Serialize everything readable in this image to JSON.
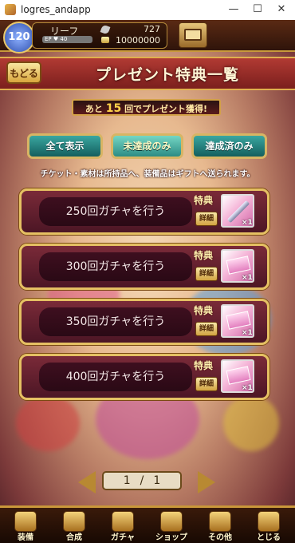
{
  "window": {
    "title": "logres_andapp",
    "buttons": [
      "—",
      "☐",
      "✕"
    ]
  },
  "status": {
    "level": "120",
    "player_name": "リーフ",
    "ep_label": "EP ♥ 40",
    "currency_a": "727",
    "currency_b": "10000000",
    "mail_icon": "present-box-icon"
  },
  "header": {
    "back_label": "もどる",
    "title": "プレゼント特典一覧"
  },
  "counter": {
    "prefix": "あと",
    "count": "15",
    "suffix": "回でプレゼント獲得!"
  },
  "filters": [
    {
      "label": "全て表示",
      "active": false
    },
    {
      "label": "未達成のみ",
      "active": true
    },
    {
      "label": "達成済のみ",
      "active": false
    }
  ],
  "note": "チケット・素材は所持品へ、装備品はギフトへ送られます。",
  "missions": [
    {
      "label": "250回ガチャを行う",
      "bonus": "特典",
      "detail": "詳細",
      "reward_icon": "sword-icon",
      "qty": "×1"
    },
    {
      "label": "300回ガチャを行う",
      "bonus": "特典",
      "detail": "詳細",
      "reward_icon": "ticket-icon",
      "qty": "×1"
    },
    {
      "label": "350回ガチャを行う",
      "bonus": "特典",
      "detail": "詳細",
      "reward_icon": "ticket-icon",
      "qty": "×1"
    },
    {
      "label": "400回ガチャを行う",
      "bonus": "特典",
      "detail": "詳細",
      "reward_icon": "ticket-icon",
      "qty": "×1"
    }
  ],
  "pager": {
    "current": "1",
    "sep": "/",
    "total": "1"
  },
  "nav": [
    {
      "label": "装備",
      "icon": "sword-icon"
    },
    {
      "label": "合成",
      "icon": "hammer-icon"
    },
    {
      "label": "ガチャ",
      "icon": "gacha-icon"
    },
    {
      "label": "ショップ",
      "icon": "shop-icon"
    },
    {
      "label": "その他",
      "icon": "gear-icon"
    },
    {
      "label": "とじる",
      "icon": "close-icon"
    }
  ],
  "colors": {
    "header_red": "#9c2b28",
    "gold": "#e0b04f",
    "teal": "#2c8c84"
  }
}
